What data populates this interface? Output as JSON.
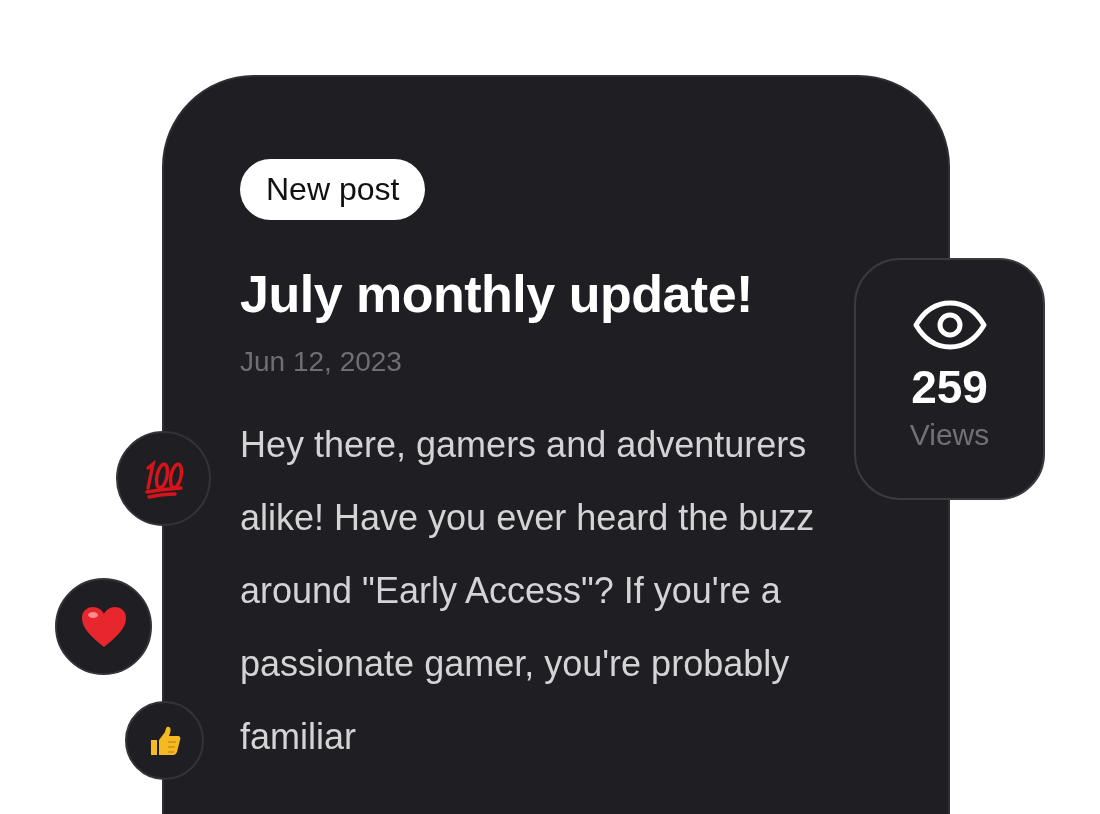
{
  "post": {
    "badge": "New post",
    "title": "July monthly update!",
    "date": "Jun 12, 2023",
    "body": "Hey there, gamers and adventurers alike! Have you ever heard the buzz around \"Early Access\"? If you're a passionate gamer, you're probably familiar"
  },
  "views": {
    "count": "259",
    "label": "Views"
  },
  "reactions": [
    {
      "kind": "hundred"
    },
    {
      "kind": "heart"
    },
    {
      "kind": "thumbs-up"
    }
  ]
}
